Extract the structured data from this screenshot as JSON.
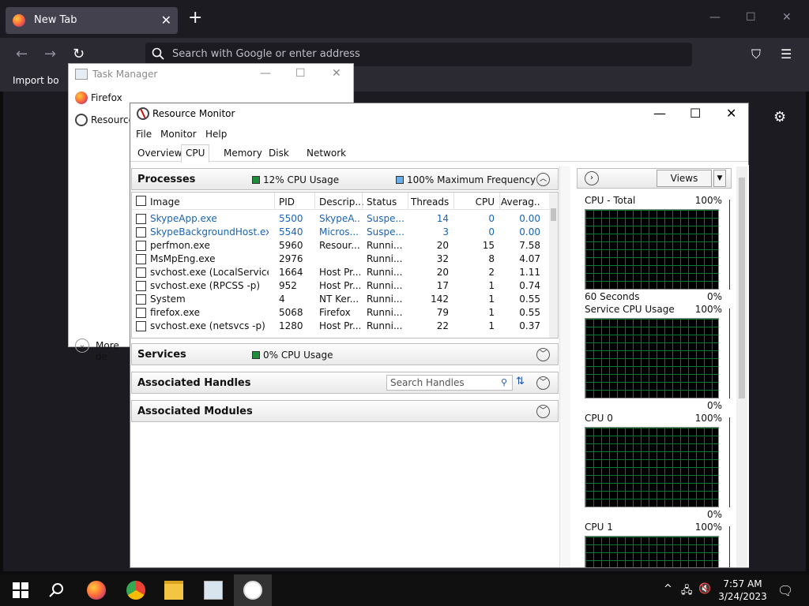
{
  "firefox": {
    "tab_title": "New Tab",
    "tab_close": "✕",
    "new_tab": "+",
    "url_placeholder": "Search with Google or enter address",
    "import_label": "Import bo"
  },
  "window_controls": {
    "minimize": "—",
    "maximize": "☐",
    "close": "✕"
  },
  "task_manager": {
    "title": "Task Manager",
    "items": [
      {
        "label": "Firefox"
      },
      {
        "label": "Resource"
      }
    ],
    "more_details": "More de"
  },
  "resource_monitor": {
    "title": "Resource Monitor",
    "menu": [
      "File",
      "Monitor",
      "Help"
    ],
    "tabs": [
      "Overview",
      "CPU",
      "Memory",
      "Disk",
      "Network"
    ],
    "active_tab": "CPU",
    "processes": {
      "header": "Processes",
      "cpu_usage": "12% CPU Usage",
      "max_frequency": "100% Maximum Frequency",
      "columns": [
        "Image",
        "PID",
        "Descrip...",
        "Status",
        "Threads",
        "CPU",
        "Averag..."
      ],
      "rows": [
        {
          "image": "SkypeApp.exe",
          "pid": "5500",
          "desc": "SkypeA...",
          "status": "Suspe...",
          "threads": "14",
          "cpu": "0",
          "avg": "0.00",
          "suspended": true
        },
        {
          "image": "SkypeBackgroundHost.exe",
          "pid": "5540",
          "desc": "Micros...",
          "status": "Suspe...",
          "threads": "3",
          "cpu": "0",
          "avg": "0.00",
          "suspended": true
        },
        {
          "image": "perfmon.exe",
          "pid": "5960",
          "desc": "Resour...",
          "status": "Runni...",
          "threads": "20",
          "cpu": "15",
          "avg": "7.58",
          "suspended": false
        },
        {
          "image": "MsMpEng.exe",
          "pid": "2976",
          "desc": "",
          "status": "Runni...",
          "threads": "32",
          "cpu": "8",
          "avg": "4.07",
          "suspended": false
        },
        {
          "image": "svchost.exe (LocalServiceNo...",
          "pid": "1664",
          "desc": "Host Pr...",
          "status": "Runni...",
          "threads": "20",
          "cpu": "2",
          "avg": "1.11",
          "suspended": false
        },
        {
          "image": "svchost.exe (RPCSS -p)",
          "pid": "952",
          "desc": "Host Pr...",
          "status": "Runni...",
          "threads": "17",
          "cpu": "1",
          "avg": "0.74",
          "suspended": false
        },
        {
          "image": "System",
          "pid": "4",
          "desc": "NT Ker...",
          "status": "Runni...",
          "threads": "142",
          "cpu": "1",
          "avg": "0.55",
          "suspended": false
        },
        {
          "image": "firefox.exe",
          "pid": "5068",
          "desc": "Firefox",
          "status": "Runni...",
          "threads": "79",
          "cpu": "1",
          "avg": "0.55",
          "suspended": false
        },
        {
          "image": "svchost.exe (netsvcs -p)",
          "pid": "1280",
          "desc": "Host Pr...",
          "status": "Runni...",
          "threads": "22",
          "cpu": "1",
          "avg": "0.37",
          "suspended": false
        }
      ]
    },
    "services": {
      "header": "Services",
      "cpu_usage": "0% CPU Usage"
    },
    "handles": {
      "header": "Associated Handles",
      "search_placeholder": "Search Handles"
    },
    "modules": {
      "header": "Associated Modules"
    },
    "graphs": {
      "views_label": "Views",
      "panels": [
        {
          "title": "CPU - Total",
          "max": "100%",
          "bottom_left": "60 Seconds",
          "bottom_right": "0%"
        },
        {
          "title": "Service CPU Usage",
          "max": "100%",
          "bottom_left": "",
          "bottom_right": "0%"
        },
        {
          "title": "CPU 0",
          "max": "100%",
          "bottom_left": "",
          "bottom_right": "0%"
        },
        {
          "title": "CPU 1",
          "max": "100%",
          "bottom_left": "",
          "bottom_right": ""
        }
      ]
    }
  },
  "taskbar": {
    "time": "7:57 AM",
    "date": "3/24/2023"
  },
  "colors": {
    "cpu_usage_swatch": "#1e8c3a",
    "frequency_swatch": "#6aaee8",
    "suspended_text": "#1a64b5",
    "graph_grid": "#0b7a2b"
  }
}
